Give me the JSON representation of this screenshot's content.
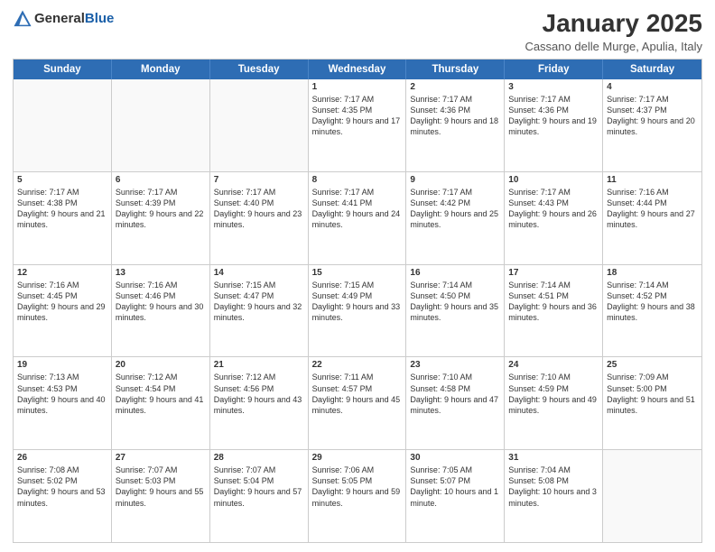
{
  "header": {
    "logo_general": "General",
    "logo_blue": "Blue",
    "month_year": "January 2025",
    "location": "Cassano delle Murge, Apulia, Italy"
  },
  "days_of_week": [
    "Sunday",
    "Monday",
    "Tuesday",
    "Wednesday",
    "Thursday",
    "Friday",
    "Saturday"
  ],
  "weeks": [
    [
      {
        "day": "",
        "empty": true
      },
      {
        "day": "",
        "empty": true
      },
      {
        "day": "",
        "empty": true
      },
      {
        "day": "1",
        "sunrise": "7:17 AM",
        "sunset": "4:35 PM",
        "daylight": "9 hours and 17 minutes."
      },
      {
        "day": "2",
        "sunrise": "7:17 AM",
        "sunset": "4:36 PM",
        "daylight": "9 hours and 18 minutes."
      },
      {
        "day": "3",
        "sunrise": "7:17 AM",
        "sunset": "4:36 PM",
        "daylight": "9 hours and 19 minutes."
      },
      {
        "day": "4",
        "sunrise": "7:17 AM",
        "sunset": "4:37 PM",
        "daylight": "9 hours and 20 minutes."
      }
    ],
    [
      {
        "day": "5",
        "sunrise": "7:17 AM",
        "sunset": "4:38 PM",
        "daylight": "9 hours and 21 minutes."
      },
      {
        "day": "6",
        "sunrise": "7:17 AM",
        "sunset": "4:39 PM",
        "daylight": "9 hours and 22 minutes."
      },
      {
        "day": "7",
        "sunrise": "7:17 AM",
        "sunset": "4:40 PM",
        "daylight": "9 hours and 23 minutes."
      },
      {
        "day": "8",
        "sunrise": "7:17 AM",
        "sunset": "4:41 PM",
        "daylight": "9 hours and 24 minutes."
      },
      {
        "day": "9",
        "sunrise": "7:17 AM",
        "sunset": "4:42 PM",
        "daylight": "9 hours and 25 minutes."
      },
      {
        "day": "10",
        "sunrise": "7:17 AM",
        "sunset": "4:43 PM",
        "daylight": "9 hours and 26 minutes."
      },
      {
        "day": "11",
        "sunrise": "7:16 AM",
        "sunset": "4:44 PM",
        "daylight": "9 hours and 27 minutes."
      }
    ],
    [
      {
        "day": "12",
        "sunrise": "7:16 AM",
        "sunset": "4:45 PM",
        "daylight": "9 hours and 29 minutes."
      },
      {
        "day": "13",
        "sunrise": "7:16 AM",
        "sunset": "4:46 PM",
        "daylight": "9 hours and 30 minutes."
      },
      {
        "day": "14",
        "sunrise": "7:15 AM",
        "sunset": "4:47 PM",
        "daylight": "9 hours and 32 minutes."
      },
      {
        "day": "15",
        "sunrise": "7:15 AM",
        "sunset": "4:49 PM",
        "daylight": "9 hours and 33 minutes."
      },
      {
        "day": "16",
        "sunrise": "7:14 AM",
        "sunset": "4:50 PM",
        "daylight": "9 hours and 35 minutes."
      },
      {
        "day": "17",
        "sunrise": "7:14 AM",
        "sunset": "4:51 PM",
        "daylight": "9 hours and 36 minutes."
      },
      {
        "day": "18",
        "sunrise": "7:14 AM",
        "sunset": "4:52 PM",
        "daylight": "9 hours and 38 minutes."
      }
    ],
    [
      {
        "day": "19",
        "sunrise": "7:13 AM",
        "sunset": "4:53 PM",
        "daylight": "9 hours and 40 minutes."
      },
      {
        "day": "20",
        "sunrise": "7:12 AM",
        "sunset": "4:54 PM",
        "daylight": "9 hours and 41 minutes."
      },
      {
        "day": "21",
        "sunrise": "7:12 AM",
        "sunset": "4:56 PM",
        "daylight": "9 hours and 43 minutes."
      },
      {
        "day": "22",
        "sunrise": "7:11 AM",
        "sunset": "4:57 PM",
        "daylight": "9 hours and 45 minutes."
      },
      {
        "day": "23",
        "sunrise": "7:10 AM",
        "sunset": "4:58 PM",
        "daylight": "9 hours and 47 minutes."
      },
      {
        "day": "24",
        "sunrise": "7:10 AM",
        "sunset": "4:59 PM",
        "daylight": "9 hours and 49 minutes."
      },
      {
        "day": "25",
        "sunrise": "7:09 AM",
        "sunset": "5:00 PM",
        "daylight": "9 hours and 51 minutes."
      }
    ],
    [
      {
        "day": "26",
        "sunrise": "7:08 AM",
        "sunset": "5:02 PM",
        "daylight": "9 hours and 53 minutes."
      },
      {
        "day": "27",
        "sunrise": "7:07 AM",
        "sunset": "5:03 PM",
        "daylight": "9 hours and 55 minutes."
      },
      {
        "day": "28",
        "sunrise": "7:07 AM",
        "sunset": "5:04 PM",
        "daylight": "9 hours and 57 minutes."
      },
      {
        "day": "29",
        "sunrise": "7:06 AM",
        "sunset": "5:05 PM",
        "daylight": "9 hours and 59 minutes."
      },
      {
        "day": "30",
        "sunrise": "7:05 AM",
        "sunset": "5:07 PM",
        "daylight": "10 hours and 1 minute."
      },
      {
        "day": "31",
        "sunrise": "7:04 AM",
        "sunset": "5:08 PM",
        "daylight": "10 hours and 3 minutes."
      },
      {
        "day": "",
        "empty": true
      }
    ]
  ]
}
